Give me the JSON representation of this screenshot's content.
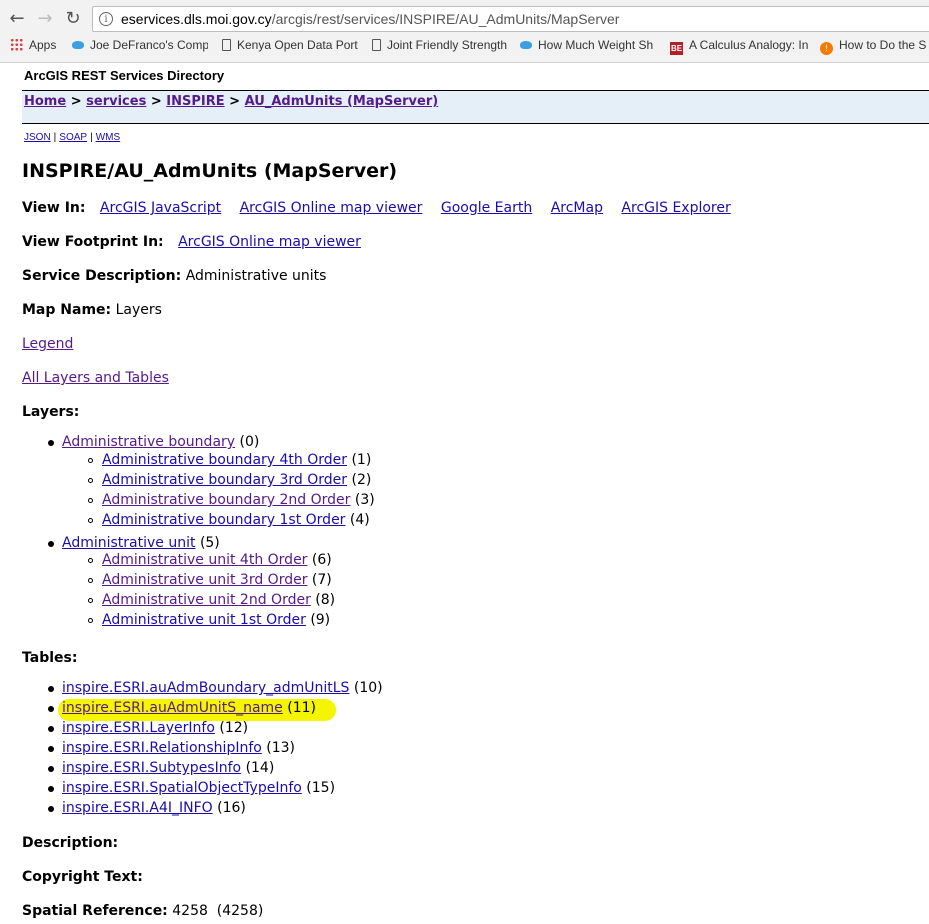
{
  "browser": {
    "url_host": "eservices.dls.moi.gov.cy",
    "url_path": "/arcgis/rest/services/INSPIRE/AU_AdmUnits/MapServer",
    "info_glyph": "i",
    "bookmarks": [
      "Apps",
      "Joe DeFranco's Comp",
      "Kenya Open Data Port",
      "Joint Friendly Strength",
      "How Much Weight Sh",
      "A Calculus Analogy: In",
      "How to Do the S"
    ],
    "bookmark_badges": {
      "be": "BE",
      "orange": "!"
    }
  },
  "directory_title": "ArcGIS REST Services Directory",
  "breadcrumbs": [
    "Home",
    "services",
    "INSPIRE",
    "AU_AdmUnits (MapServer)"
  ],
  "breadcrumb_sep": ">",
  "formats": [
    "JSON",
    "SOAP",
    "WMS"
  ],
  "format_sep": "|",
  "service_title": "INSPIRE/AU_AdmUnits (MapServer)",
  "view_in": {
    "label": "View In:",
    "links": [
      "ArcGIS JavaScript",
      "ArcGIS Online map viewer",
      "Google Earth",
      "ArcMap",
      "ArcGIS Explorer"
    ]
  },
  "view_footprint": {
    "label": "View Footprint In:",
    "link": "ArcGIS Online map viewer"
  },
  "service_description": {
    "label": "Service Description:",
    "value": "Administrative units"
  },
  "map_name": {
    "label": "Map Name:",
    "value": "Layers"
  },
  "legend_link": "Legend",
  "all_layers_link": "All Layers and Tables",
  "layers_heading": "Layers:",
  "layers": [
    {
      "name": "Administrative boundary",
      "id": "(0)",
      "children": [
        {
          "name": "Administrative boundary 4th Order",
          "id": "(1)"
        },
        {
          "name": "Administrative boundary 3rd Order",
          "id": "(2)"
        },
        {
          "name": "Administrative boundary 2nd Order",
          "id": "(3)"
        },
        {
          "name": "Administrative boundary 1st Order",
          "id": "(4)"
        }
      ]
    },
    {
      "name": "Administrative unit",
      "id": "(5)",
      "children": [
        {
          "name": "Administrative unit 4th Order",
          "id": "(6)"
        },
        {
          "name": "Administrative unit 3rd Order",
          "id": "(7)"
        },
        {
          "name": "Administrative unit 2nd Order",
          "id": "(8)"
        },
        {
          "name": "Administrative unit 1st Order",
          "id": "(9)"
        }
      ]
    }
  ],
  "tables_heading": "Tables:",
  "tables": [
    {
      "name": "inspire.ESRI.auAdmBoundary_admUnitLS",
      "id": "(10)"
    },
    {
      "name": "inspire.ESRI.auAdmUnitS_name",
      "id": "(11)",
      "highlighted": true
    },
    {
      "name": "inspire.ESRI.LayerInfo",
      "id": "(12)"
    },
    {
      "name": "inspire.ESRI.RelationshipInfo",
      "id": "(13)"
    },
    {
      "name": "inspire.ESRI.SubtypesInfo",
      "id": "(14)"
    },
    {
      "name": "inspire.ESRI.SpatialObjectTypeInfo",
      "id": "(15)"
    },
    {
      "name": "inspire.ESRI.A4I_INFO",
      "id": "(16)"
    }
  ],
  "description_label": "Description:",
  "copyright_label": "Copyright Text:",
  "spatial_reference": {
    "label": "Spatial Reference:",
    "value": "4258  (4258)"
  },
  "colors": {
    "link": "#1a0dab",
    "visited": "#551a8b",
    "nav_band": "#e4eff7",
    "highlight": "#f5f500"
  }
}
